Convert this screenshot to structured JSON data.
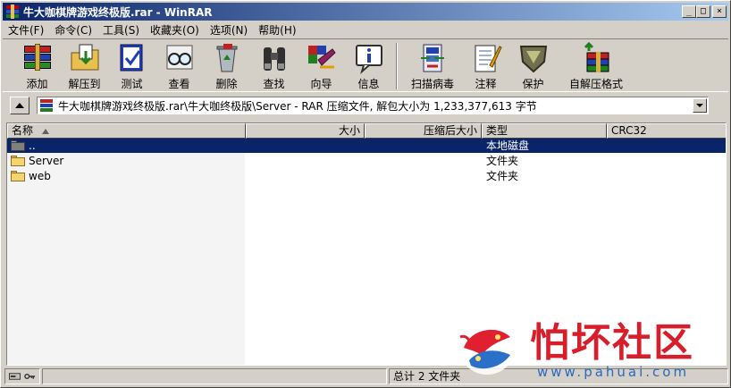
{
  "window": {
    "title": "牛大咖棋牌游戏终极版.rar - WinRAR",
    "controls": {
      "minimize": "_",
      "maximize": "□",
      "close": "×"
    }
  },
  "menu": [
    {
      "label": "文件(F)"
    },
    {
      "label": "命令(C)"
    },
    {
      "label": "工具(S)"
    },
    {
      "label": "收藏夹(O)"
    },
    {
      "label": "选项(N)"
    },
    {
      "label": "帮助(H)"
    }
  ],
  "toolbar": {
    "add": {
      "label": "添加",
      "icon": "archive-books-icon"
    },
    "extract": {
      "label": "解压到",
      "icon": "extract-folder-icon"
    },
    "test": {
      "label": "测试",
      "icon": "test-book-icon"
    },
    "view": {
      "label": "查看",
      "icon": "glasses-icon"
    },
    "delete": {
      "label": "删除",
      "icon": "recycle-bin-icon"
    },
    "find": {
      "label": "查找",
      "icon": "binoculars-icon"
    },
    "wizard": {
      "label": "向导",
      "icon": "wizard-icon"
    },
    "info": {
      "label": "信息",
      "icon": "info-icon"
    },
    "scan": {
      "label": "扫描病毒",
      "icon": "virus-scan-icon"
    },
    "comment": {
      "label": "注释",
      "icon": "comment-notepad-icon"
    },
    "protect": {
      "label": "保护",
      "icon": "shield-icon"
    },
    "sfx": {
      "label": "自解压格式",
      "icon": "sfx-archive-icon"
    }
  },
  "address": {
    "path": "牛大咖棋牌游戏终极版.rar\\牛大咖终极版\\Server - RAR 压缩文件, 解包大小为 1,233,377,613 字节"
  },
  "columns": {
    "name": "名称",
    "size": "大小",
    "packed": "压缩后大小",
    "type": "类型",
    "crc": "CRC32"
  },
  "files": [
    {
      "name": "..",
      "size": "",
      "packed": "",
      "type": "本地磁盘",
      "crc": ""
    },
    {
      "name": "Server",
      "size": "",
      "packed": "",
      "type": "文件夹",
      "crc": ""
    },
    {
      "name": "web",
      "size": "",
      "packed": "",
      "type": "文件夹",
      "crc": ""
    }
  ],
  "status": {
    "summary": "总计 2 文件夹"
  },
  "watermark": {
    "title": "怕坏社区",
    "url": "www.pahuai.com"
  },
  "colors": {
    "titlebar_start": "#0a246a",
    "selection": "#0a246a",
    "watermark_red": "#d81e2a",
    "watermark_blue": "#2a6ac0"
  }
}
